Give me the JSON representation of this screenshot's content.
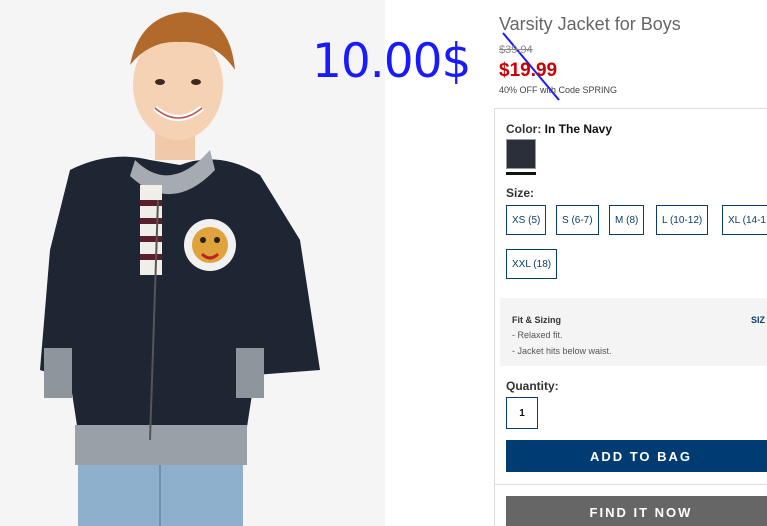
{
  "product": {
    "title": "Varsity Jacket for Boys",
    "original_price": "$39.94",
    "sale_price": "$19.99",
    "promo": "40% OFF with Code SPRING"
  },
  "annotation": {
    "price": "10.00$",
    "color": "#1a1aff"
  },
  "color": {
    "label": "Color:",
    "value": "In The Navy",
    "swatch_color": "#2a2f3a"
  },
  "size": {
    "label": "Size:",
    "options": [
      "XS (5)",
      "S (6-7)",
      "M (8)",
      "L (10-12)",
      "XL (14-1",
      "XXL (18)"
    ]
  },
  "fit": {
    "title": "Fit & Sizing",
    "size_link": "SIZ",
    "items": [
      "- Relaxed fit.",
      "- Jacket hits below waist."
    ]
  },
  "quantity": {
    "label": "Quantity:",
    "value": "1"
  },
  "actions": {
    "add_to_bag": "ADD TO BAG",
    "find_it_now": "FIND IT NOW"
  },
  "colors": {
    "primary_button": "#003b71",
    "sale_red": "#cc0000",
    "secondary_button": "#666666"
  }
}
